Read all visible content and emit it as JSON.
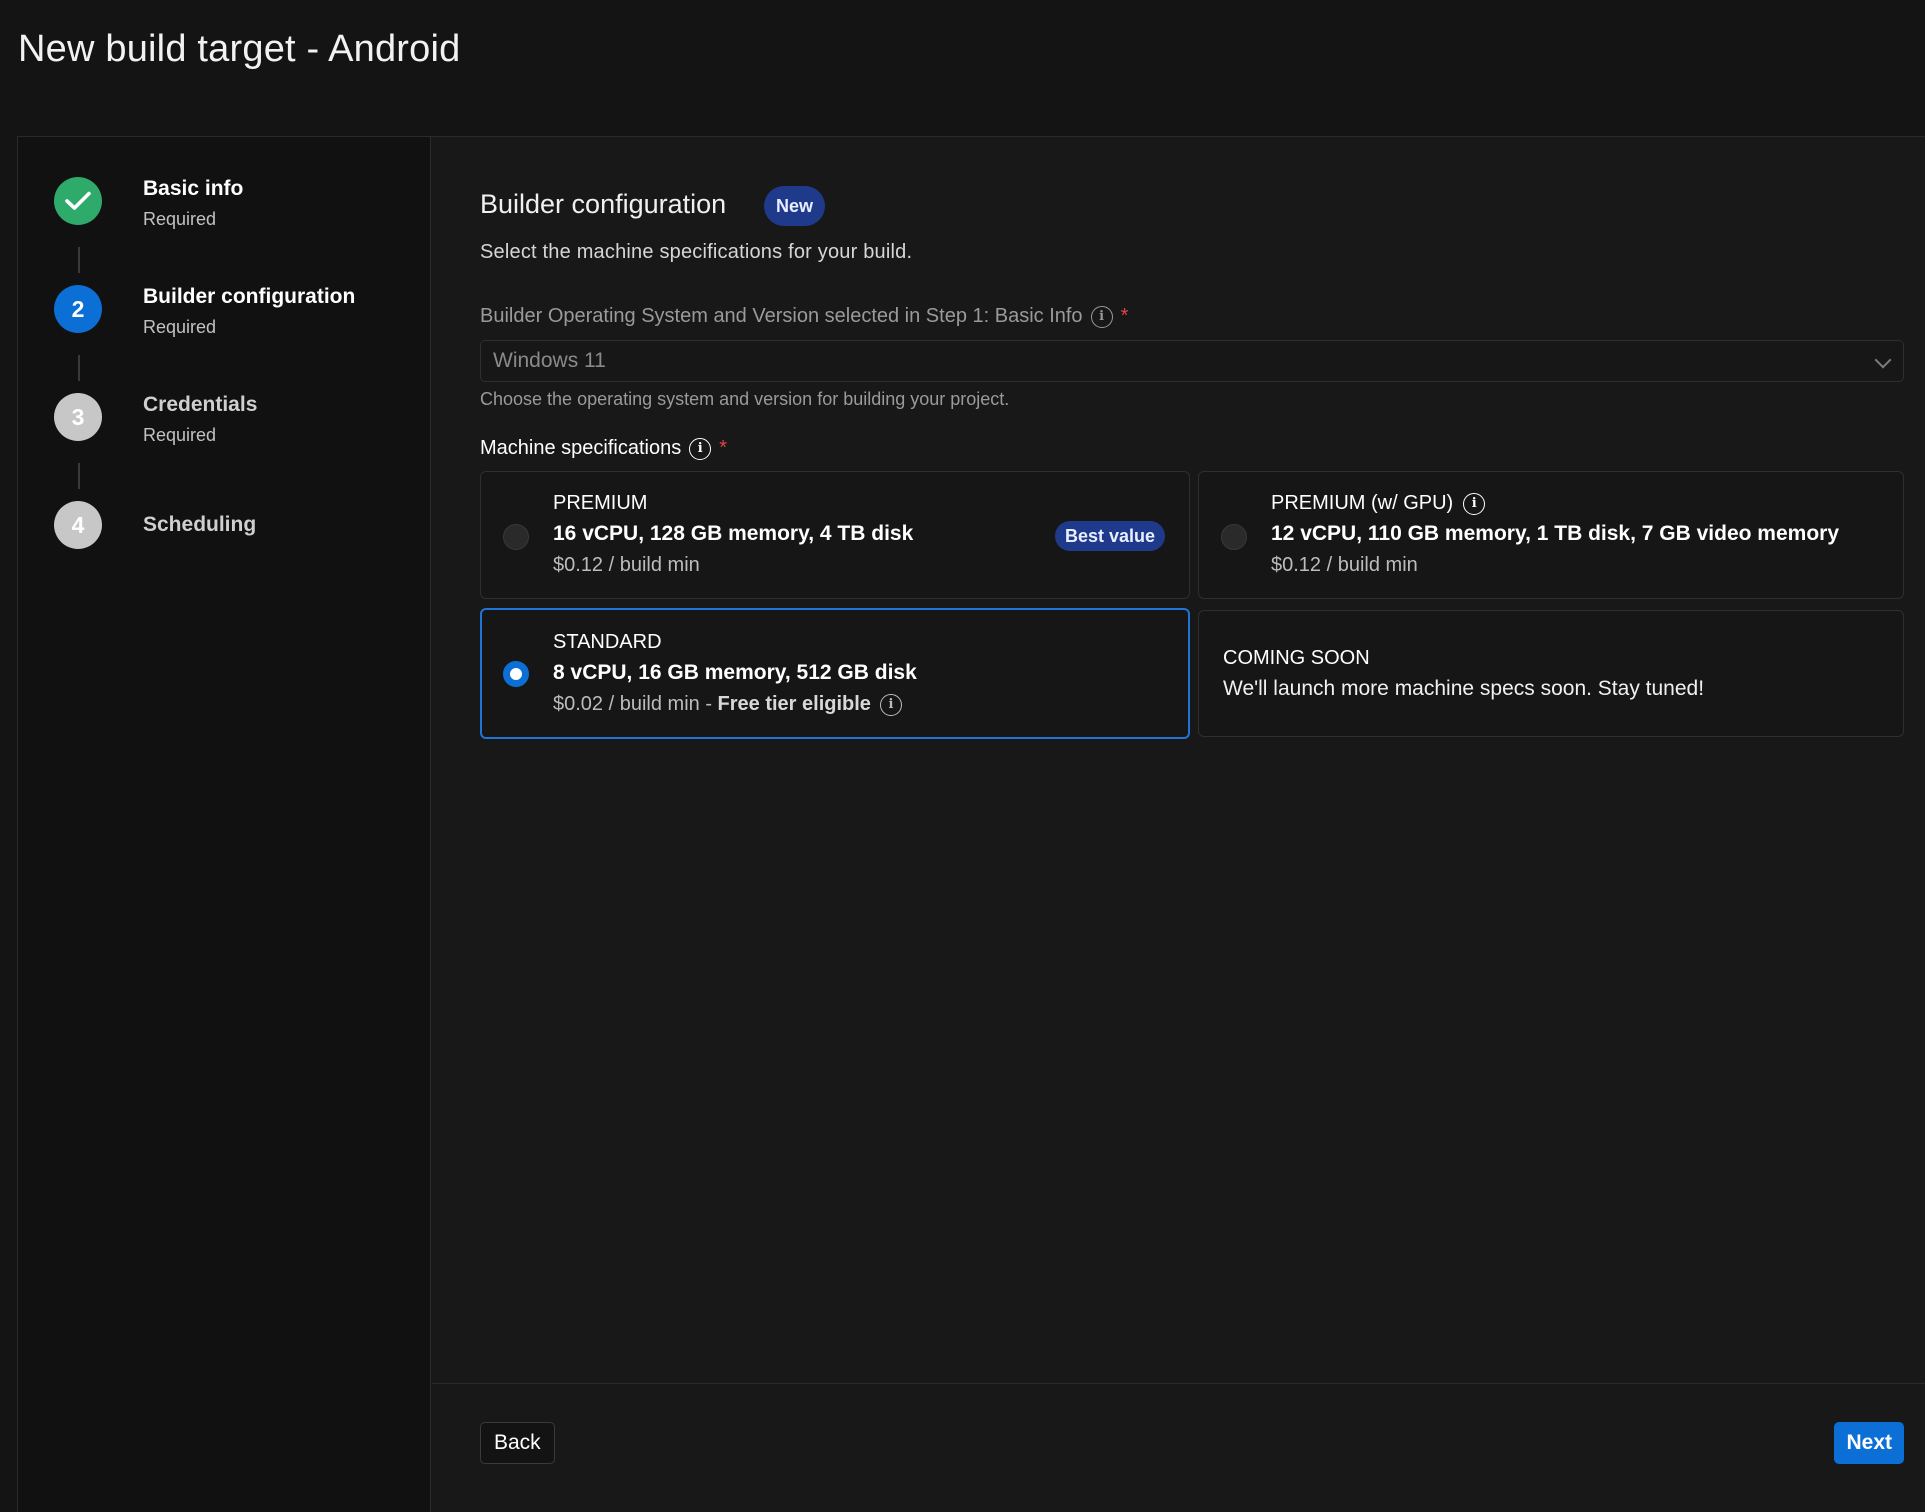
{
  "page": {
    "title": "New build target - Android"
  },
  "steps": [
    {
      "number": "",
      "title": "Basic info",
      "subtitle": "Required",
      "status": "done",
      "icon": "check-icon"
    },
    {
      "number": "2",
      "title": "Builder configuration",
      "subtitle": "Required",
      "status": "active"
    },
    {
      "number": "3",
      "title": "Credentials",
      "subtitle": "Required",
      "status": "pending"
    },
    {
      "number": "4",
      "title": "Scheduling",
      "subtitle": "",
      "status": "pending"
    }
  ],
  "section": {
    "title": "Builder configuration",
    "badge": "New",
    "description": "Select the machine specifications for your build."
  },
  "os_field": {
    "label": "Builder Operating System and Version selected in Step 1: Basic Info",
    "required_mark": "*",
    "value": "Windows 11",
    "help": "Choose the operating system and version for building your project."
  },
  "machine_specs": {
    "label": "Machine specifications",
    "required_mark": "*",
    "options": [
      {
        "tier": "PREMIUM",
        "specs": "16 vCPU, 128 GB memory, 4 TB disk",
        "price": "$0.12 / build min",
        "badge": "Best value",
        "selected": false
      },
      {
        "tier": "PREMIUM (w/ GPU)",
        "specs": "12 vCPU, 110 GB memory, 1 TB disk, 7 GB video memory",
        "price": "$0.12 / build min",
        "selected": false
      },
      {
        "tier": "STANDARD",
        "specs": "8 vCPU, 16 GB memory, 512 GB disk",
        "price": "$0.02 / build min - ",
        "price_note": "Free tier eligible",
        "selected": true
      }
    ],
    "coming_soon": {
      "title": "COMING SOON",
      "text": "We'll launch more machine specs soon. Stay tuned!"
    }
  },
  "footer": {
    "back_label": "Back",
    "next_label": "Next"
  },
  "colors": {
    "accent": "#0b6fd6",
    "success": "#2eaa6b",
    "badge": "#1f3a8a",
    "required": "#e0444a"
  }
}
